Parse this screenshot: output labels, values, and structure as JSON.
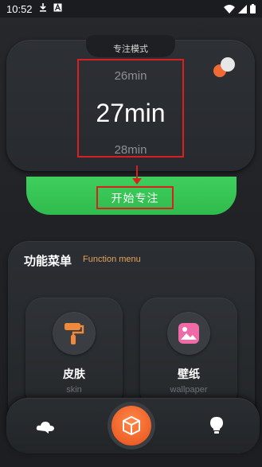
{
  "status_bar": {
    "time": "10:52",
    "icons": [
      "download-icon",
      "a-badge-icon",
      "wifi-icon",
      "signal-icon",
      "battery-icon"
    ]
  },
  "focus": {
    "mode_label": "专注模式",
    "prev_time": "26min",
    "current_time": "27min",
    "next_time": "28min",
    "start_label": "开始专注"
  },
  "menu": {
    "title": "功能菜单",
    "subtitle": "Function menu",
    "items": [
      {
        "label": "皮肤",
        "sub": "skin",
        "icon": "paint-roller-icon"
      },
      {
        "label": "壁纸",
        "sub": "wallpaper",
        "icon": "image-icon"
      }
    ]
  },
  "nav": {
    "items": [
      "cloud-icon",
      "cube-icon",
      "lightbulb-icon"
    ]
  },
  "colors": {
    "background": "#202225",
    "accent_green": "#34c053",
    "accent_orange": "#ef6a34",
    "highlight_red": "#d92020",
    "subtitle_orange": "#e8a15a"
  }
}
